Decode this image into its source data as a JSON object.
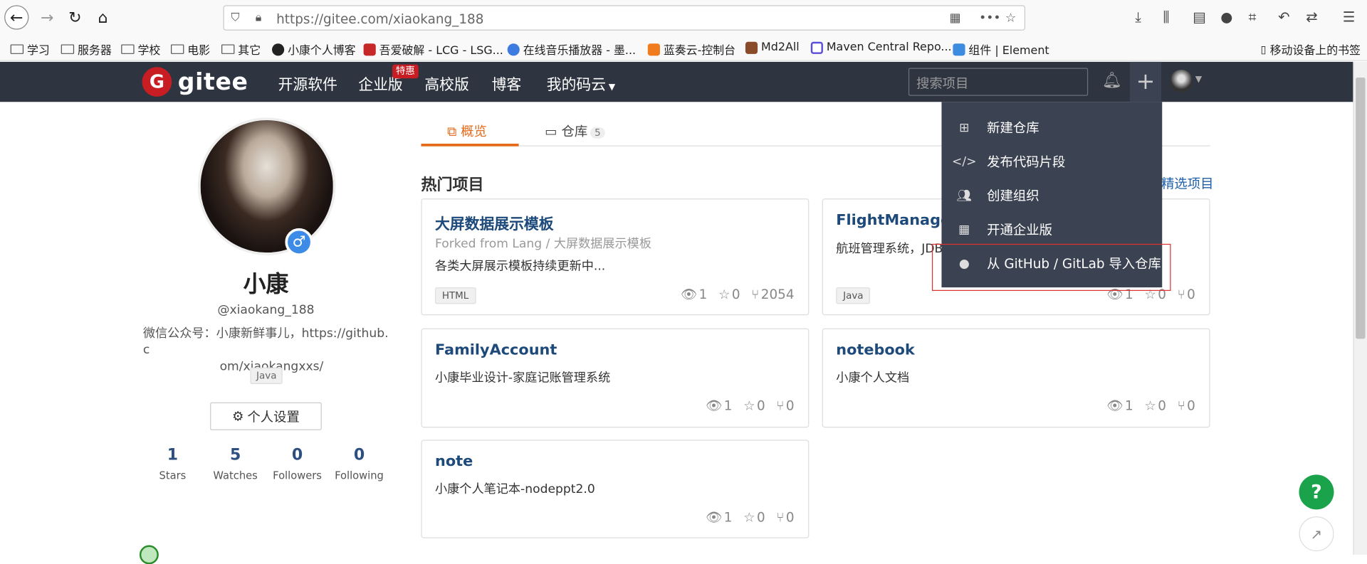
{
  "browser": {
    "url": "https://gitee.com/xiaokang_188",
    "bookmarks": [
      {
        "label": "学习",
        "icon": "folder-icon"
      },
      {
        "label": "服务器",
        "icon": "folder-icon"
      },
      {
        "label": "学校",
        "icon": "folder-icon"
      },
      {
        "label": "电影",
        "icon": "folder-icon"
      },
      {
        "label": "其它",
        "icon": "folder-icon"
      },
      {
        "label": "小康个人博客",
        "icon": "site-icon"
      },
      {
        "label": "吾爱破解 - LCG - LSG...",
        "icon": "site-icon"
      },
      {
        "label": "在线音乐播放器 - 墨...",
        "icon": "globe-icon"
      },
      {
        "label": "蓝奏云-控制台",
        "icon": "site-icon"
      },
      {
        "label": "Md2All",
        "icon": "site-icon"
      },
      {
        "label": "Maven Central Repo...",
        "icon": "site-icon"
      },
      {
        "label": "组件 | Element",
        "icon": "site-icon"
      }
    ],
    "mobile_bookmarks": "移动设备上的书签"
  },
  "header": {
    "logo": "gitee",
    "nav": [
      "开源软件",
      "企业版",
      "高校版",
      "博客",
      "我的码云"
    ],
    "hot_badge": "特惠",
    "search_placeholder": "搜索项目"
  },
  "profile": {
    "name": "小康",
    "username": "@xiaokang_188",
    "bio_line1": "微信公众号：小康新鲜事儿，https://github.c",
    "bio_line2": "om/xiaokangxxs/",
    "lang": "Java",
    "settings_label": "个人设置",
    "stats": [
      {
        "num": "1",
        "label": "Stars"
      },
      {
        "num": "5",
        "label": "Watches"
      },
      {
        "num": "0",
        "label": "Followers"
      },
      {
        "num": "0",
        "label": "Following"
      }
    ]
  },
  "tabs": {
    "overview": "概览",
    "repos": "仓库",
    "repos_count": "5"
  },
  "section": {
    "title": "热门项目",
    "link": "精选项目"
  },
  "projects": [
    {
      "title": "大屏数据展示模板",
      "fork": "Forked from Lang  / 大屏数据展示模板",
      "desc": "各类大屏展示模板持续更新中...",
      "lang": "HTML",
      "watch": "1",
      "star": "0",
      "fork_count": "2054"
    },
    {
      "title": "FlightManagem",
      "fork": "",
      "desc": "航班管理系统，JDB",
      "lang": "Java",
      "watch": "1",
      "star": "0",
      "fork_count": "0"
    },
    {
      "title": "FamilyAccount",
      "fork": "",
      "desc": "小康毕业设计-家庭记账管理系统",
      "lang": "",
      "watch": "1",
      "star": "0",
      "fork_count": "0"
    },
    {
      "title": "notebook",
      "fork": "",
      "desc": "小康个人文档",
      "lang": "",
      "watch": "1",
      "star": "0",
      "fork_count": "0"
    },
    {
      "title": "note",
      "fork": "",
      "desc": "小康个人笔记本-nodeppt2.0",
      "lang": "",
      "watch": "1",
      "star": "0",
      "fork_count": "0"
    }
  ],
  "dropdown": [
    {
      "label": "新建仓库",
      "icon": "plus-square-icon"
    },
    {
      "label": "发布代码片段",
      "icon": "code-icon"
    },
    {
      "label": "创建组织",
      "icon": "group-icon"
    },
    {
      "label": "开通企业版",
      "icon": "building-icon"
    },
    {
      "label": "从 GitHub / GitLab 导入仓库",
      "icon": "github-icon"
    }
  ],
  "colors": {
    "header_bg": "#2e3440",
    "accent": "#e56919",
    "link": "#1d4a7a",
    "brand_red": "#c71d23",
    "help_green": "#1aa34a"
  }
}
